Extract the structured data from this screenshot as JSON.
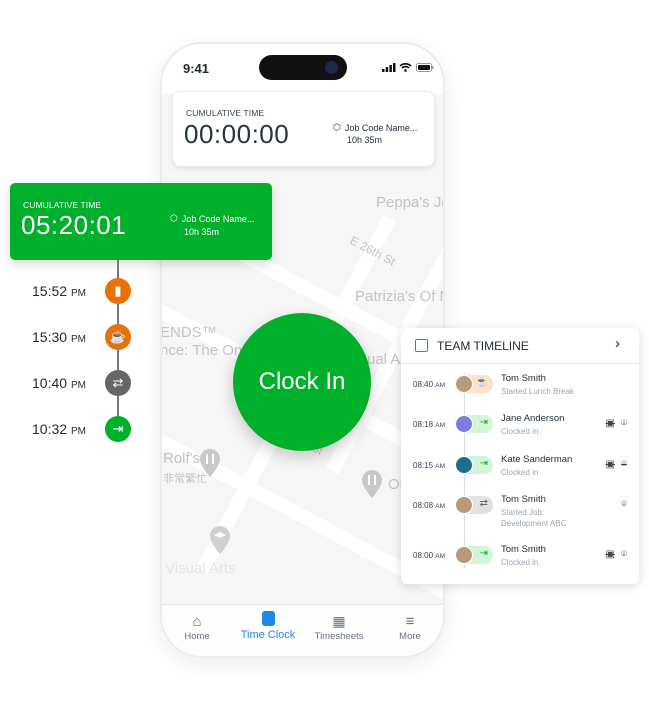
{
  "status_bar": {
    "time": "9:41"
  },
  "top_card": {
    "label": "CUMULATIVE TIME",
    "time": "00:00:00",
    "job_name": "Job Code Name...",
    "job_duration": "10h 35m"
  },
  "green_card": {
    "label": "CUMULATIVE TIME",
    "time": "05:20:01",
    "job_name": "Job Code Name...",
    "job_duration": "10h 35m",
    "color": "#00b02a"
  },
  "timeline": [
    {
      "time": "15:52",
      "period": "PM",
      "icon": "battery-icon",
      "color": "#e8710a"
    },
    {
      "time": "15:30",
      "period": "PM",
      "icon": "coffee-icon",
      "color": "#e8710a"
    },
    {
      "time": "10:40",
      "period": "PM",
      "icon": "swap-icon",
      "color": "#666666"
    },
    {
      "time": "10:32",
      "period": "PM",
      "icon": "clock-in-icon",
      "color": "#00b02a"
    }
  ],
  "map_labels": [
    "Peppa's Je",
    "E 26th St",
    "Patrizia's Of M",
    "ENDS™",
    "nce: The One",
    "ual A",
    "Rolf's",
    "非常繁忙",
    "Or",
    "St",
    "Visual Arts"
  ],
  "clock_in_label": "Clock In",
  "team_timeline": {
    "title": "TEAM TIMELINE",
    "entries": [
      {
        "time": "08:40",
        "period": "AM",
        "name": "Tom Smith",
        "status": "Started Lunch Break",
        "action": "coffee",
        "camera_off": false,
        "location": "none"
      },
      {
        "time": "08:18",
        "period": "AM",
        "name": "Jane Anderson",
        "status": "Clocked in",
        "action": "clock-in",
        "camera_off": true,
        "location": "on"
      },
      {
        "time": "08:15",
        "period": "AM",
        "name": "Kate Sanderman",
        "status": "Clocked in",
        "action": "clock-in",
        "camera_off": true,
        "location": "off"
      },
      {
        "time": "08:08",
        "period": "AM",
        "name": "Tom Smith",
        "status": "Started Job:",
        "status2": "Development ABC",
        "action": "swap",
        "camera_off": false,
        "location": "on"
      },
      {
        "time": "08:00",
        "period": "AM",
        "name": "Tom Smith",
        "status": "Clocked in",
        "action": "clock-in",
        "camera_off": true,
        "location": "on"
      }
    ]
  },
  "bottom_nav": [
    {
      "label": "Home",
      "icon": "home-icon"
    },
    {
      "label": "Time Clock",
      "icon": "time-clock-icon",
      "active": true
    },
    {
      "label": "Timesheets",
      "icon": "timesheets-icon"
    },
    {
      "label": "More",
      "icon": "menu-icon"
    }
  ]
}
